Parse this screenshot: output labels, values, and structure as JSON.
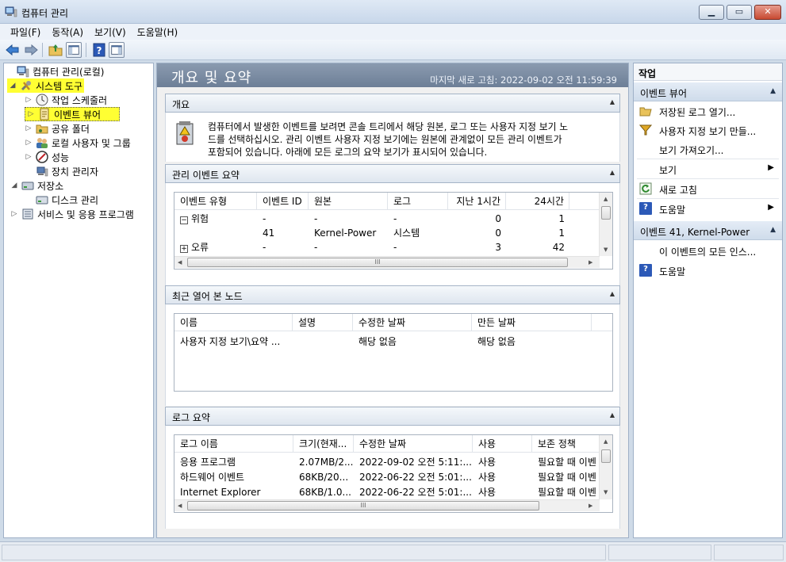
{
  "window": {
    "title": "컴퓨터 관리"
  },
  "menubar": [
    "파일(F)",
    "동작(A)",
    "보기(V)",
    "도움말(H)"
  ],
  "tree": {
    "root": "컴퓨터 관리(로컬)",
    "system_tools": "시스템 도구",
    "task_scheduler": "작업 스케줄러",
    "event_viewer": "이벤트 뷰어",
    "shared_folders": "공유 폴더",
    "local_users": "로컬 사용자 및 그룹",
    "performance": "성능",
    "device_manager": "장치 관리자",
    "storage": "저장소",
    "disk_management": "디스크 관리",
    "services_apps": "서비스 및 응용 프로그램"
  },
  "main": {
    "title": "개요 및 요약",
    "last_refresh": "마지막 새로 고침: 2022-09-02 오전 11:59:39",
    "overview": {
      "title": "개요",
      "text": "컴퓨터에서 발생한 이벤트를 보려면 콘솔 트리에서 해당 원본, 로그 또는 사용자 지정 보기 노드를 선택하십시오. 관리 이벤트 사용자 지정 보기에는 원본에 관계없이 모든 관리 이벤트가 포함되어 있습니다. 아래에 모든 로그의 요약 보기가 표시되어 있습니다.",
      "line1": "컴퓨터에서 발생한 이벤트를 보려면 콘솔 트리에서 해당 원본, 로그 또는 사용자 지정 보기 노",
      "line2": "드를 선택하십시오. 관리 이벤트 사용자 지정 보기에는 원본에 관계없이 모든 관리 이벤트가",
      "line3": "포함되어 있습니다. 아래에 모든 로그의 요약 보기가 표시되어 있습니다."
    },
    "admin_summary": {
      "title": "관리 이벤트 요약",
      "columns": [
        "이벤트 유형",
        "이벤트 ID",
        "원본",
        "로그",
        "지난 1시간",
        "24시간"
      ],
      "rows": [
        [
          "위험",
          "-",
          "-",
          "-",
          "0",
          "1"
        ],
        [
          "",
          "41",
          "Kernel-Power",
          "시스템",
          "0",
          "1"
        ],
        [
          "오류",
          "-",
          "-",
          "-",
          "3",
          "42"
        ]
      ],
      "hscroll_grip": "III"
    },
    "recent_nodes": {
      "title": "최근 열어 본 노드",
      "columns": [
        "이름",
        "설명",
        "수정한 날짜",
        "만든 날짜"
      ],
      "rows": [
        [
          "사용자 지정 보기\\요약 ...",
          "",
          "해당 없음",
          "해당 없음"
        ]
      ]
    },
    "log_summary": {
      "title": "로그 요약",
      "columns": [
        "로그 이름",
        "크기(현재...",
        "수정한 날짜",
        "사용",
        "보존 정책"
      ],
      "rows": [
        [
          "응용 프로그램",
          "2.07MB/2...",
          "2022-09-02 오전 5:11:...",
          "사용",
          "필요할 때 이벤"
        ],
        [
          "하드웨어 이벤트",
          "68KB/20...",
          "2022-06-22 오전 5:01:...",
          "사용",
          "필요할 때 이벤"
        ],
        [
          "Internet Explorer",
          "68KB/1.0...",
          "2022-06-22 오전 5:01:...",
          "사용",
          "필요할 때 이벤"
        ]
      ],
      "hscroll_grip": "III"
    }
  },
  "actions": {
    "header": "작업",
    "group1": "이벤트 뷰어",
    "items1": [
      "저장된 로그 열기...",
      "사용자 지정 보기 만들...",
      "보기 가져오기...",
      "보기",
      "새로 고침",
      "도움말"
    ],
    "group2": "이벤트 41, Kernel-Power",
    "items2": [
      "이 이벤트의 모든 인스...",
      "도움말"
    ]
  }
}
